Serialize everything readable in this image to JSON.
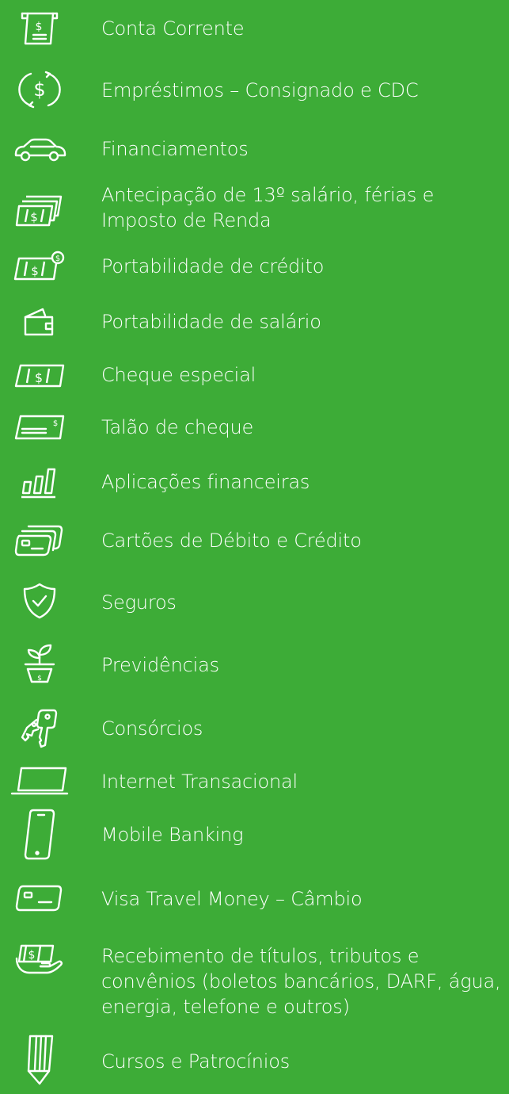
{
  "colors": {
    "background": "#3dac37",
    "foreground": "#ffffff"
  },
  "services": [
    {
      "icon": "atm-cash-icon",
      "label": "Conta Corrente"
    },
    {
      "icon": "dollar-refresh-icon",
      "label": "Empréstimos – Consignado e CDC"
    },
    {
      "icon": "car-icon",
      "label": "Financiamentos"
    },
    {
      "icon": "banknotes-stack-icon",
      "label": "Antecipação de 13º salário, férias e Imposto de Renda"
    },
    {
      "icon": "banknote-coin-icon",
      "label": "Portabilidade de crédito"
    },
    {
      "icon": "wallet-icon",
      "label": "Portabilidade de salário"
    },
    {
      "icon": "banknote-icon",
      "label": "Cheque especial"
    },
    {
      "icon": "checkbook-icon",
      "label": "Talão de cheque"
    },
    {
      "icon": "bar-chart-icon",
      "label": "Aplicações financeiras"
    },
    {
      "icon": "cards-icon",
      "label": "Cartões de Débito e Crédito"
    },
    {
      "icon": "shield-check-icon",
      "label": "Seguros"
    },
    {
      "icon": "plant-pot-icon",
      "label": "Previdências"
    },
    {
      "icon": "keys-icon",
      "label": "Consórcios"
    },
    {
      "icon": "laptop-icon",
      "label": "Internet Transacional"
    },
    {
      "icon": "smartphone-icon",
      "label": "Mobile Banking"
    },
    {
      "icon": "card-icon",
      "label": "Visa Travel Money – Câmbio"
    },
    {
      "icon": "hand-money-icon",
      "label": "Recebimento de títulos, tributos e convênios (boletos bancários, DARF, água, energia, telefone e outros)"
    },
    {
      "icon": "pencil-icon",
      "label": "Cursos e Patrocínios"
    }
  ]
}
